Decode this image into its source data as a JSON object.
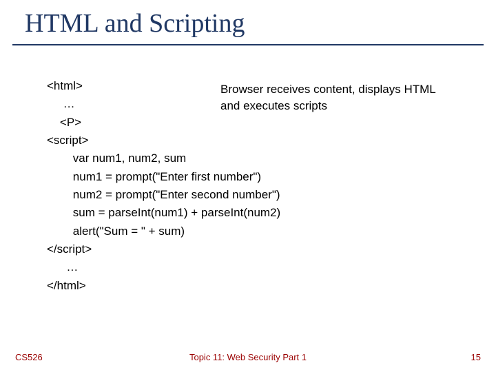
{
  "title": "HTML and Scripting",
  "callout": "Browser receives content, displays HTML and executes scripts",
  "code": {
    "l1": "<html>",
    "l2": "     …",
    "l3": "    <P>",
    "l4": "<script>",
    "l5": "        var num1, num2, sum",
    "l6": "        num1 = prompt(\"Enter first number\")",
    "l7": "        num2 = prompt(\"Enter second number\")",
    "l8": "        sum = parseInt(num1) + parseInt(num2)",
    "l9": "        alert(\"Sum = \" + sum)",
    "l10": "</script>",
    "l11": "      …",
    "l12": "</html>"
  },
  "footer": {
    "left": "CS526",
    "center": "Topic 11: Web Security Part 1",
    "page": "15"
  }
}
